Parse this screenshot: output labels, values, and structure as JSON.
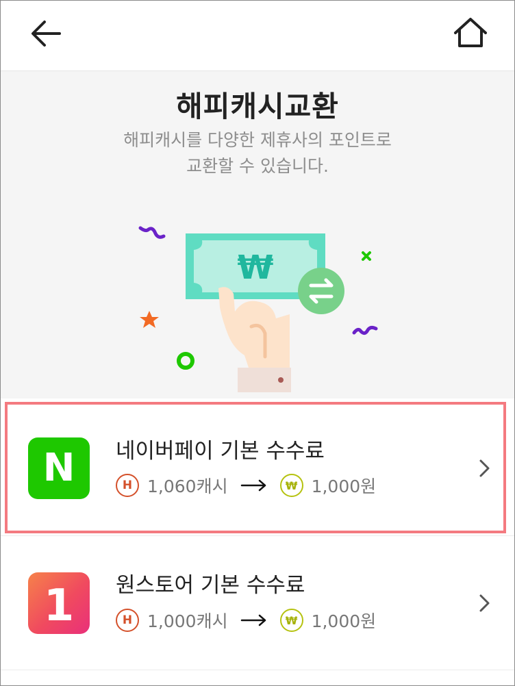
{
  "header": {
    "back_icon": "arrow-left-icon",
    "home_icon": "home-icon"
  },
  "hero": {
    "title": "해피캐시교환",
    "description_line1": "해피캐시를 다양한 제휴사의 포인트로",
    "description_line2": "교환할 수 있습니다.",
    "illustration_currency_symbol": "₩"
  },
  "exchange_items": [
    {
      "title": "네이버페이 기본 수수료",
      "logo_letter": "N",
      "logo_color": "#1ec800",
      "from_badge": "H",
      "from_amount": "1,060캐시",
      "to_badge": "₩",
      "to_amount": "1,000원",
      "highlighted": true
    },
    {
      "title": "원스토어 기본 수수료",
      "logo_letter": "1",
      "logo_color": "#f0505a",
      "from_badge": "H",
      "from_amount": "1,000캐시",
      "to_badge": "₩",
      "to_amount": "1,000원",
      "highlighted": false
    }
  ],
  "colors": {
    "highlight_border": "#f47a80",
    "cash_badge": "#d4502a",
    "won_badge": "#b5c20f"
  }
}
